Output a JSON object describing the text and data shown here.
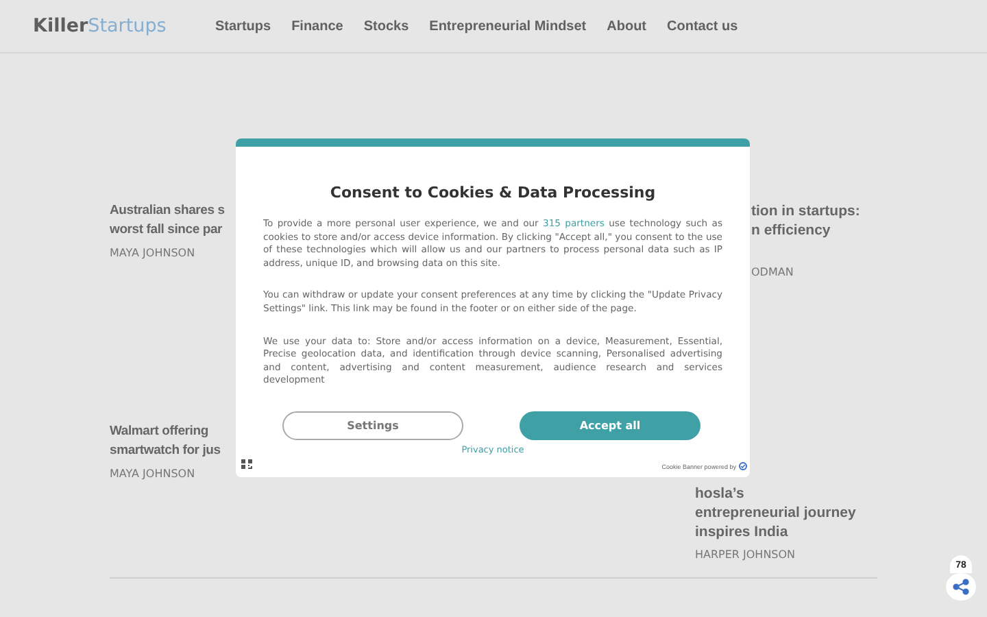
{
  "logo": {
    "part_1": "Killer",
    "part_2": "Startups"
  },
  "nav": [
    "Startups",
    "Finance",
    "Stocks",
    "Entrepreneurial Mindset",
    "About",
    "Contact us"
  ],
  "articles_left": [
    {
      "title_lines": [
        "Australian shares s",
        "worst fall since par"
      ],
      "author": "MAYA JOHNSON"
    },
    {
      "title_lines": [
        "Walmart offering",
        "smartwatch for jus"
      ],
      "author": "MAYA JOHNSON"
    }
  ],
  "articles_right": [
    {
      "title_lines": [
        "tion in startups:",
        "n efficiency"
      ],
      "author": "ODMAN"
    },
    {
      "title_lines": [
        "hosla’s",
        "entrepreneurial journey",
        "inspires India"
      ],
      "author": "HARPER JOHNSON"
    }
  ],
  "share": {
    "count": "78"
  },
  "consent": {
    "title": "Consent to Cookies & Data Processing",
    "paragraphs": [
      {
        "text": "To provide a more personal user experience, we and our ",
        "link": "315 partners",
        "text_after": " use technology such as cookies to store and/or access device information. By clicking \"Accept all,\" you consent to the use of these technologies which will allow us and our partners to process personal data such as IP address, unique ID, and browsing data on this site."
      },
      {
        "text": "You can withdraw or update your consent preferences at any time by clicking the \"Update Privacy Settings\" link. This link may be found in the footer or on either side of the page."
      },
      {
        "text": "We use your data to: Store and/or access information on a device, Measurement, Essential, Precise geolocation data, and identification through device scanning, Personalised advertising and content, advertising and content measurement, audience research and services development"
      }
    ],
    "settings_button": "Settings",
    "accept_button": "Accept all",
    "privacy_link": "Privacy notice",
    "powered_by": "Cookie Banner powered by"
  }
}
